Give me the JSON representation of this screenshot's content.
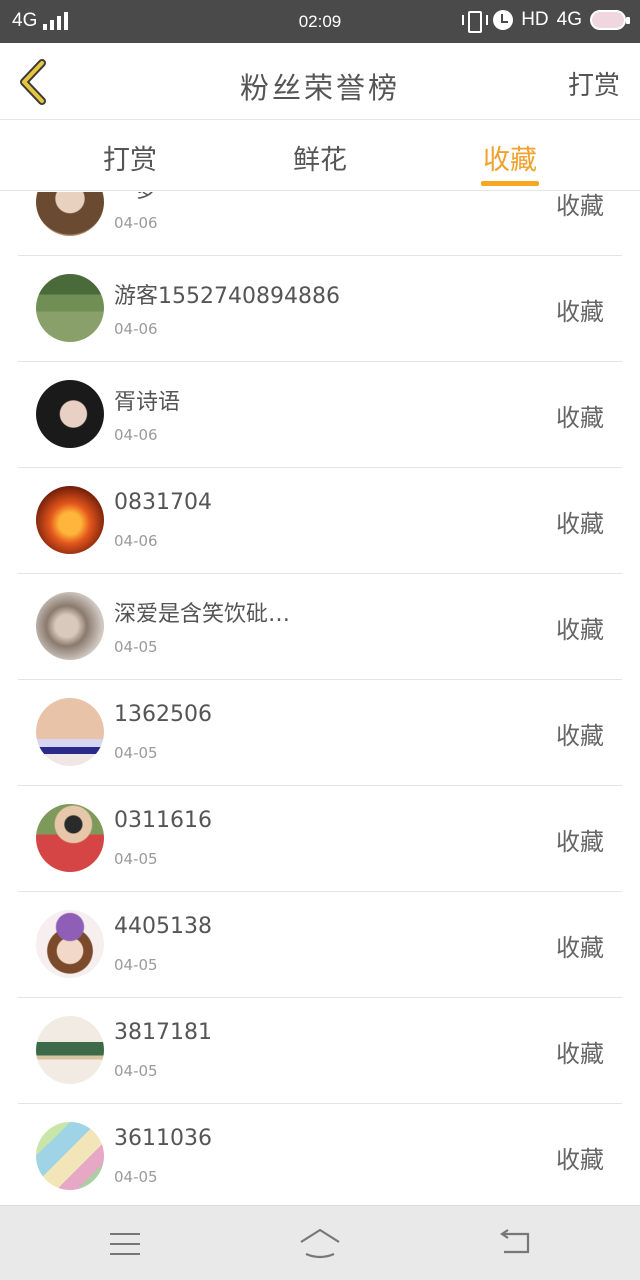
{
  "status_bar": {
    "network": "4G",
    "time": "02:09",
    "hd": "HD",
    "network_right": "4G"
  },
  "header": {
    "title": "粉丝荣誉榜",
    "action": "打赏"
  },
  "tabs": [
    {
      "label": "打赏",
      "active": false
    },
    {
      "label": "鲜花",
      "active": false
    },
    {
      "label": "收藏",
      "active": true
    }
  ],
  "colors": {
    "accent": "#f5a623",
    "status_bar_bg": "#4a4a4a",
    "nav_bar_bg": "#e9e9e9"
  },
  "fans": [
    {
      "name": "一梦",
      "date": "04-06",
      "tag": "收藏",
      "avatar_icon": "girl-photo-avatar"
    },
    {
      "name": "游客1552740894886",
      "date": "04-06",
      "tag": "收藏",
      "avatar_icon": "garden-photo-avatar"
    },
    {
      "name": "胥诗语",
      "date": "04-06",
      "tag": "收藏",
      "avatar_icon": "girl-portrait-avatar"
    },
    {
      "name": "0831704",
      "date": "04-06",
      "tag": "收藏",
      "avatar_icon": "pumpkin-avatar"
    },
    {
      "name": "深爱是含笑饮砒…",
      "date": "04-05",
      "tag": "收藏",
      "avatar_icon": "girl-hair-avatar"
    },
    {
      "name": "1362506",
      "date": "04-05",
      "tag": "收藏",
      "avatar_icon": "blonde-girl-avatar"
    },
    {
      "name": "0311616",
      "date": "04-05",
      "tag": "收藏",
      "avatar_icon": "boy-plaid-avatar"
    },
    {
      "name": "4405138",
      "date": "04-05",
      "tag": "收藏",
      "avatar_icon": "anime-girl-avatar"
    },
    {
      "name": "3817181",
      "date": "04-05",
      "tag": "收藏",
      "avatar_icon": "photo-card-avatar"
    },
    {
      "name": "3611036",
      "date": "04-05",
      "tag": "收藏",
      "avatar_icon": "colorful-illustration-avatar"
    }
  ]
}
